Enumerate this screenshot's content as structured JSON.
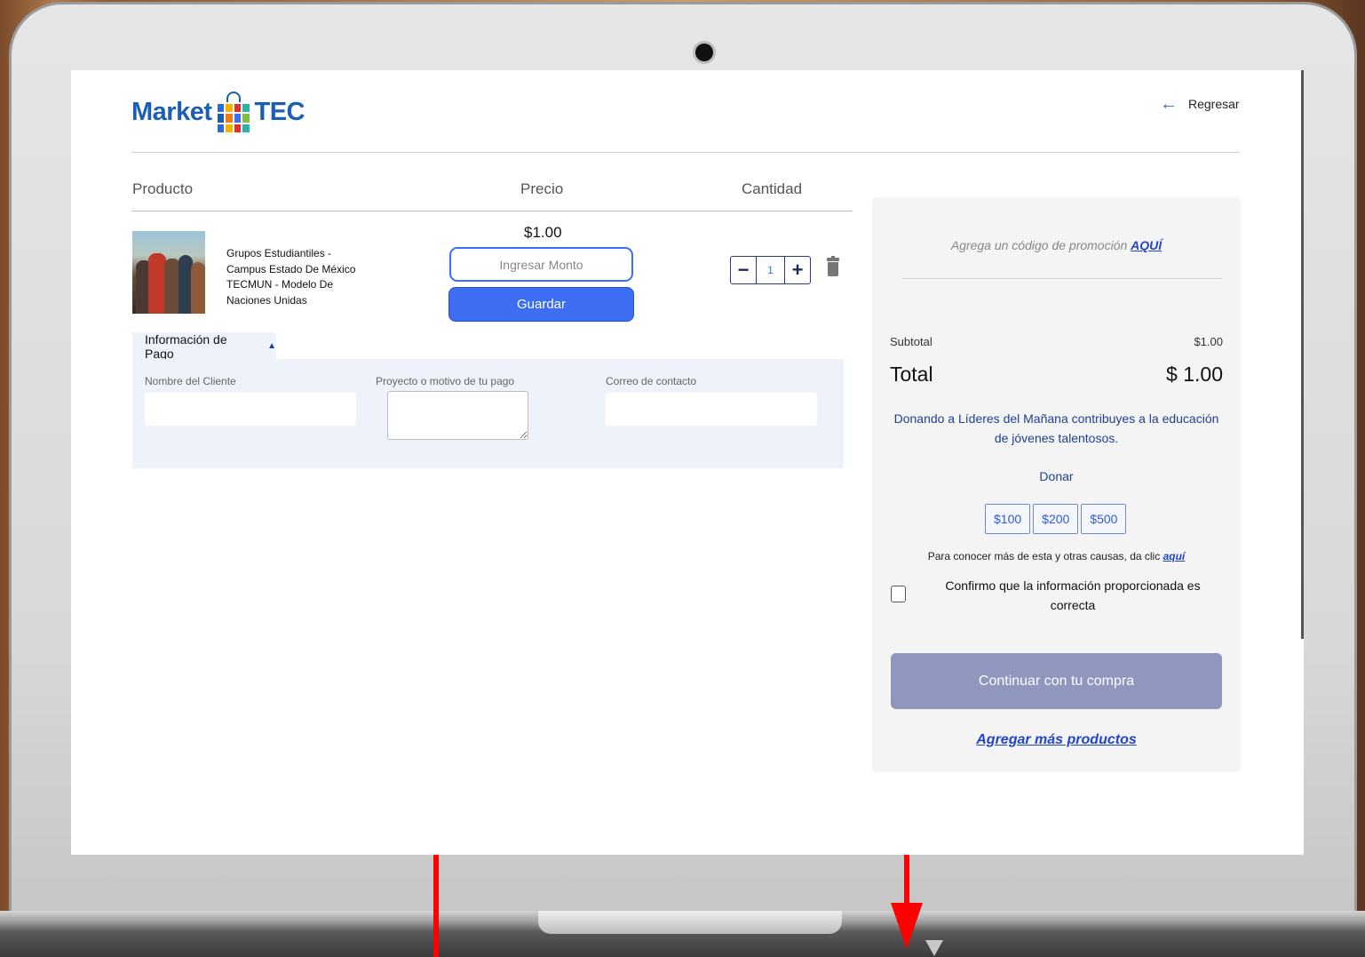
{
  "brand": {
    "logo_left": "Market",
    "logo_right": "TEC",
    "colors": [
      "#2b6cd4",
      "#f5b300",
      "#e0302b",
      "#2bb3a8",
      "#1a5fb4",
      "#f07a1a",
      "#3b6ff5",
      "#7cc142"
    ]
  },
  "header": {
    "back_label": "Regresar",
    "back_icon": "arrow-left-icon"
  },
  "table": {
    "columns": [
      "Producto",
      "Precio",
      "Cantidad"
    ]
  },
  "product": {
    "name": "Grupos Estudiantiles - Campus Estado De México TECMUN - Modelo De Naciones Unidas",
    "price": "$1.00",
    "amount_placeholder": "Ingresar Monto",
    "save_label": "Guardar",
    "quantity": "1"
  },
  "payment_info": {
    "tab_label": "Información de Pago",
    "caret": "▲",
    "fields": [
      "Nombre del Cliente",
      "Proyecto o motivo de tu pago",
      "Correo de contacto"
    ]
  },
  "summary": {
    "promo_text": "Agrega un código de promoción",
    "promo_link": "AQUÍ",
    "subtotal_label": "Subtotal",
    "subtotal_value": "$1.00",
    "total_label": "Total",
    "total_value": "$ 1.00",
    "donation_message": "Donando a Líderes del Mañana contribuyes a la educación de jóvenes talentosos.",
    "donate_title": "Donar",
    "donate_amounts": [
      "$100",
      "$200",
      "$500"
    ],
    "causes_text": "Para conocer más de esta y otras causas, da clic",
    "causes_link": "aquí",
    "confirm_text": "Confirmo que la información proporcionada es correcta",
    "continue_label": "Continuar con tu compra",
    "add_more_label": "Agregar más productos"
  },
  "accent_colors": {
    "primary": "#3d6df2",
    "disabled": "#8f97be",
    "link": "#2244cc",
    "panel": "#eef2fb",
    "annotation": "#ff0000"
  }
}
